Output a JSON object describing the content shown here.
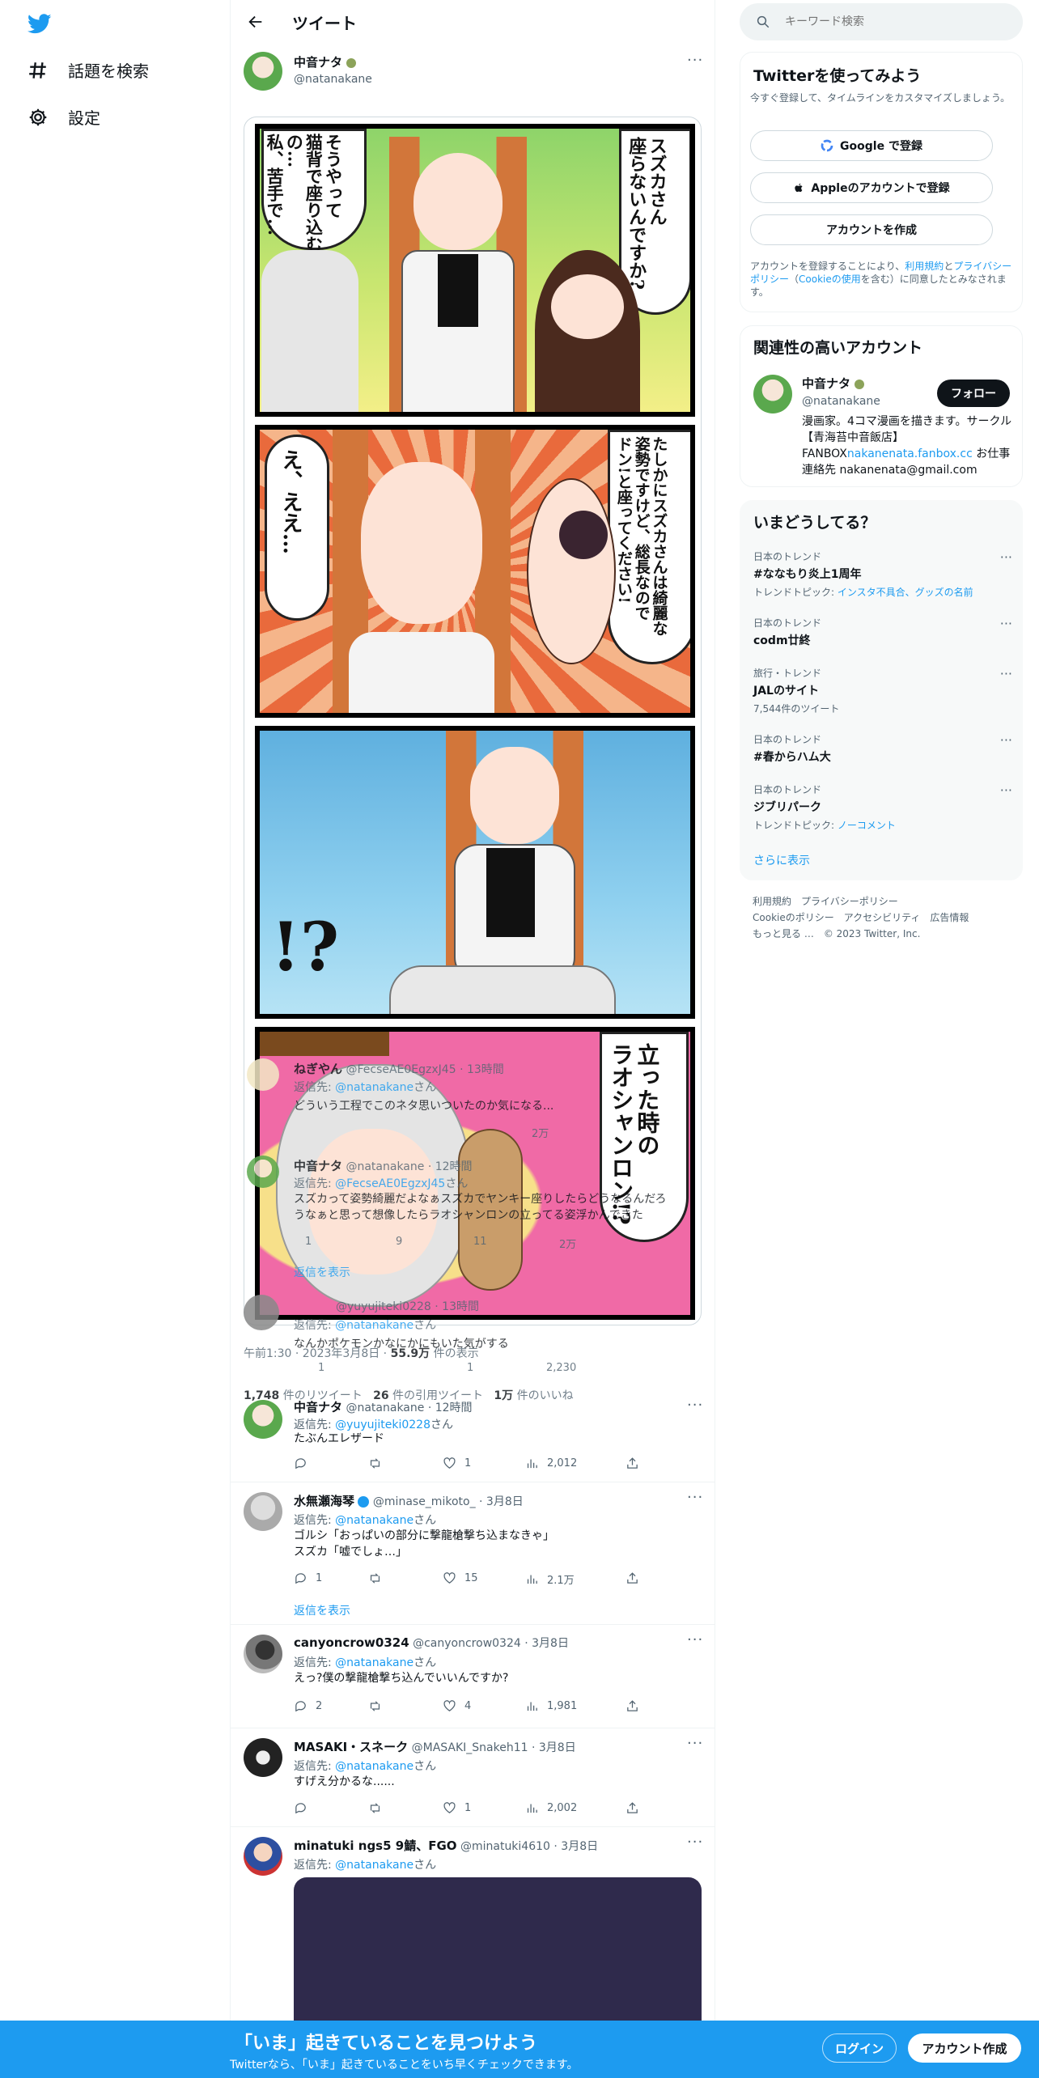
{
  "nav": {
    "items": [
      {
        "label": "話題を検索",
        "icon": "hashtag-icon"
      },
      {
        "label": "設定",
        "icon": "gear-icon"
      }
    ]
  },
  "header": {
    "title": "ツイート"
  },
  "tweet": {
    "author_name": "中音ナタ",
    "author_handle": "@natanakane",
    "timestamp": "午前1:30 · 2023年3月8日 · ",
    "views": "55.9万",
    "views_suffix": " 件の表示",
    "retweets_num": "1,748",
    "retweets_label": " 件のリツイート",
    "quotes_num": "26",
    "quotes_label": " 件の引用ツイート",
    "likes_num": "1万",
    "likes_label": " 件のいいね",
    "comic": {
      "p1_right": "スズカさん\n座らないんですか?",
      "p1_left": "そうやって\n猫背で座り込む\nの…\n私、苦手で…",
      "p2_right": "たしかにスズカさんは綺麗な\n姿勢ですけど、総長なので\nドン!と座ってください!",
      "p2_left": "え、ええ…",
      "p3_mark": "!?",
      "p4_right": "立った時の\nラオシャンロン!?"
    }
  },
  "replies": [
    {
      "name": "ねぎやん",
      "handle": "@FecseAE0EgzxJ45",
      "time": "· 13時間",
      "reply_to_prefix": "返信先: ",
      "reply_to": "@natanakane",
      "reply_to_suffix": "さん",
      "text": "どういう工程でこのネタ思いついたのか気になる...",
      "views": "2万"
    },
    {
      "name": "中音ナタ",
      "handle": "@natanakane",
      "time": "· 12時間",
      "reply_to_prefix": "返信先: ",
      "reply_to": "@FecseAE0EgzxJ45",
      "reply_to_suffix": "さん",
      "text": "スズカって姿勢綺麗だよなぁスズカでヤンキー座りしたらどうなるんだろうなぁと思って想像したらラオシャンロンの立ってる姿浮かんできた",
      "replies": "1",
      "retweets": "9",
      "likes": "11",
      "views": "2万",
      "show_replies": "返信を表示"
    },
    {
      "name": "yuyujitei",
      "handle": "@yuyujiteki0228",
      "time": "· 13時間",
      "reply_to_prefix": "返信先: ",
      "reply_to": "@natanakane",
      "reply_to_suffix": "さん",
      "text": "なんかポケモンかなにかにもいた気がする",
      "replies": "1",
      "likes": "1",
      "views": "2,230"
    },
    {
      "name": "中音ナタ",
      "handle": "@natanakane",
      "time": "· 12時間",
      "reply_to_prefix": "返信先: ",
      "reply_to": "@yuyujiteki0228",
      "reply_to_suffix": "さん",
      "text": "たぶんエレザード",
      "likes": "1",
      "views": "2,012"
    },
    {
      "name": "水無瀬海琴",
      "handle": "@minase_mikoto_",
      "time": "· 3月8日",
      "reply_to_prefix": "返信先: ",
      "reply_to": "@natanakane",
      "reply_to_suffix": "さん",
      "text": "ゴルシ「おっぱいの部分に撃龍槍撃ち込まなきゃ」\nスズカ「嘘でしょ…」",
      "replies": "1",
      "likes": "15",
      "views": "2.1万",
      "show_replies": "返信を表示"
    },
    {
      "name": "canyoncrow0324",
      "handle": "@canyoncrow0324",
      "time": "· 3月8日",
      "reply_to_prefix": "返信先: ",
      "reply_to": "@natanakane",
      "reply_to_suffix": "さん",
      "text": "えっ?僕の撃龍槍撃ち込んでいいんですか?",
      "replies": "2",
      "likes": "4",
      "views": "1,981"
    },
    {
      "name": "MASAKI・スネーク",
      "handle": "@MASAKI_Snakeh11",
      "time": "· 3月8日",
      "reply_to_prefix": "返信先: ",
      "reply_to": "@natanakane",
      "reply_to_suffix": "さん",
      "text": "すげえ分かるな......",
      "likes": "1",
      "views": "2,002"
    },
    {
      "name": "minatuki ngs5 9鯖、FGO",
      "handle": "@minatuki4610",
      "time": "· 3月8日",
      "reply_to_prefix": "返信先: ",
      "reply_to": "@natanakane",
      "reply_to_suffix": "さん"
    }
  ],
  "search": {
    "placeholder": "キーワード検索"
  },
  "signup_card": {
    "title": "Twitterを使ってみよう",
    "subtitle": "今すぐ登録して、タイムラインをカスタマイズしましょう。",
    "google": "Google で登録",
    "apple": "Appleのアカウントで登録",
    "create": "アカウントを作成",
    "legal_1": "アカウントを登録することにより、",
    "legal_terms": "利用規約",
    "legal_2": "と",
    "legal_privacy": "プライバシーポリシー",
    "legal_3": "（",
    "legal_cookie": "Cookieの使用",
    "legal_4": "を含む）に同意したとみなされます。"
  },
  "related": {
    "title": "関連性の高いアカウント",
    "name": "中音ナタ",
    "handle": "@natanakane",
    "follow": "フォロー",
    "bio_1": "漫画家。4コマ漫画を描きます。サークル【青海苔中音飯店】FANBOX",
    "bio_link": "nakanenata.fanbox.cc",
    "bio_2": " お仕事連絡先 nakanenata@gmail.com"
  },
  "trends": {
    "title": "いまどうしてる？",
    "items": [
      {
        "category": "日本のトレンド",
        "name": "#ななもり炎上1周年",
        "sub_prefix": "トレンドトピック: ",
        "sub_link": "インスタ不具合、グッズの名前"
      },
      {
        "category": "日本のトレンド",
        "name": "codm廿終"
      },
      {
        "category": "旅行・トレンド",
        "name": "JALのサイト",
        "sub": "7,544件のツイート"
      },
      {
        "category": "日本のトレンド",
        "name": "#春からハム大"
      },
      {
        "category": "日本のトレンド",
        "name": "ジブリパーク",
        "sub_prefix": "トレンドトピック: ",
        "sub_link": "ノーコメント"
      }
    ],
    "more": "さらに表示"
  },
  "footer": {
    "line1": "利用規約　プライバシーポリシー",
    "line2": "Cookieのポリシー　アクセシビリティ　広告情報",
    "line3": "もっと見る …　© 2023 Twitter, Inc."
  },
  "bottom_bar": {
    "title": "「いま」起きていることを見つけよう",
    "subtitle": "Twitterなら、「いま」起きていることをいち早くチェックできます。",
    "login": "ログイン",
    "signup": "アカウント作成"
  },
  "colors": {
    "accent": "#1d9bf0",
    "text": "#0f1419",
    "muted": "#536471"
  }
}
